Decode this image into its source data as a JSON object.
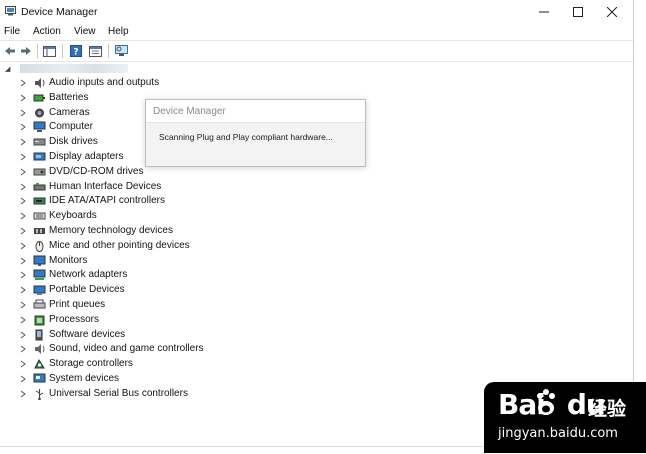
{
  "window": {
    "title": "Device Manager"
  },
  "menu": [
    "File",
    "Action",
    "View",
    "Help"
  ],
  "tree": {
    "categories": [
      {
        "label": "Audio inputs and outputs",
        "icon": "speaker-icon"
      },
      {
        "label": "Batteries",
        "icon": "battery-icon"
      },
      {
        "label": "Cameras",
        "icon": "camera-icon"
      },
      {
        "label": "Computer",
        "icon": "computer-icon"
      },
      {
        "label": "Disk drives",
        "icon": "disk-drive-icon"
      },
      {
        "label": "Display adapters",
        "icon": "display-adapter-icon"
      },
      {
        "label": "DVD/CD-ROM drives",
        "icon": "dvd-drive-icon"
      },
      {
        "label": "Human Interface Devices",
        "icon": "hid-icon"
      },
      {
        "label": "IDE ATA/ATAPI controllers",
        "icon": "ide-controller-icon"
      },
      {
        "label": "Keyboards",
        "icon": "keyboard-icon"
      },
      {
        "label": "Memory technology devices",
        "icon": "memory-icon"
      },
      {
        "label": "Mice and other pointing devices",
        "icon": "mouse-icon"
      },
      {
        "label": "Monitors",
        "icon": "monitor-icon"
      },
      {
        "label": "Network adapters",
        "icon": "network-adapter-icon"
      },
      {
        "label": "Portable Devices",
        "icon": "portable-device-icon"
      },
      {
        "label": "Print queues",
        "icon": "printer-icon"
      },
      {
        "label": "Processors",
        "icon": "processor-icon"
      },
      {
        "label": "Software devices",
        "icon": "software-device-icon"
      },
      {
        "label": "Sound, video and game controllers",
        "icon": "sound-controller-icon"
      },
      {
        "label": "Storage controllers",
        "icon": "storage-controller-icon"
      },
      {
        "label": "System devices",
        "icon": "system-device-icon"
      },
      {
        "label": "Universal Serial Bus controllers",
        "icon": "usb-icon"
      }
    ]
  },
  "dialog": {
    "title": "Device Manager",
    "message": "Scanning Plug and Play compliant hardware..."
  },
  "watermark": {
    "logo": "Bai",
    "logo_suffix": "du",
    "chinese": "经验",
    "url": "jingyan.baidu.com"
  },
  "colors": {
    "accent": "#1e72c8",
    "dialog_bg": "#f3f3f3",
    "watermark_bg": "#000000"
  }
}
